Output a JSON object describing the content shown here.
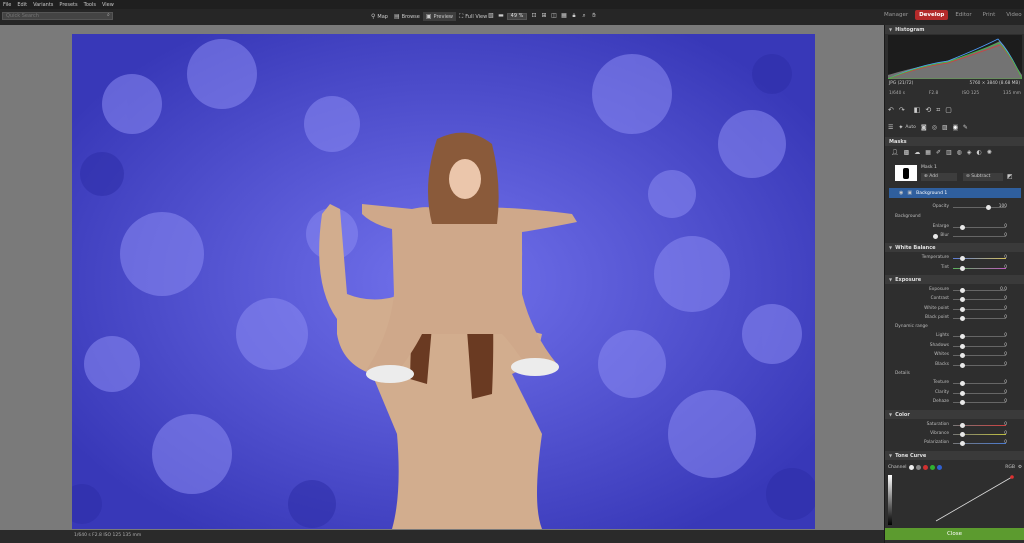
{
  "menu": [
    "File",
    "Edit",
    "Variants",
    "Presets",
    "Tools",
    "View"
  ],
  "search": {
    "placeholder": "Quick Search"
  },
  "view_modes": [
    {
      "icon": "map-pin-icon",
      "label": "Map"
    },
    {
      "icon": "folder-icon",
      "label": "Browse"
    },
    {
      "icon": "preview-icon",
      "label": "Preview"
    },
    {
      "icon": "fullscreen-icon",
      "label": "Full View"
    }
  ],
  "toolbar": {
    "zoom": "49 %"
  },
  "modules": [
    "Manager",
    "Develop",
    "Editor",
    "Print",
    "Video"
  ],
  "modules_active": "Develop",
  "status": {
    "text": "1/640 s   F2.8   ISO 125   135 mm"
  },
  "histogram": {
    "title": "Histogram",
    "file_type": "JPG",
    "index": "(21/72)",
    "dimensions": "5760 × 3840 (8.68 MB)",
    "shutter": "1/640 s",
    "aperture": "F2.8",
    "iso": "ISO 125",
    "focal": "135 mm"
  },
  "quick_labels": {
    "auto": "Auto"
  },
  "masks": {
    "title": "Masks",
    "mask_name": "Mask 1",
    "add_label": "Add",
    "subtract_label": "Subtract",
    "layer_name": "Background 1",
    "opacity_label": "Opacity",
    "opacity_value": "100",
    "background_label": "Background",
    "enlarge_label": "Enlarge",
    "enlarge_value": "0",
    "blur_label": "Blur",
    "blur_value": "0"
  },
  "white_balance": {
    "title": "White Balance",
    "rows": [
      {
        "label": "Temperature",
        "value": "0"
      },
      {
        "label": "Tint",
        "value": "0"
      }
    ]
  },
  "exposure": {
    "title": "Exposure",
    "rows": [
      {
        "label": "Exposure",
        "value": "0.0"
      },
      {
        "label": "Contrast",
        "value": "0"
      },
      {
        "label": "White point",
        "value": "0"
      },
      {
        "label": "Black point",
        "value": "0"
      }
    ],
    "dynamic_label": "Dynamic range",
    "dynamic_rows": [
      {
        "label": "Lights",
        "value": "0"
      },
      {
        "label": "Shadows",
        "value": "0"
      },
      {
        "label": "Whites",
        "value": "0"
      },
      {
        "label": "Blacks",
        "value": "0"
      }
    ],
    "details_label": "Details",
    "details_rows": [
      {
        "label": "Texture",
        "value": "0"
      },
      {
        "label": "Clarity",
        "value": "0"
      },
      {
        "label": "Dehaze",
        "value": "0"
      }
    ]
  },
  "color": {
    "title": "Color",
    "rows": [
      {
        "label": "Saturation",
        "value": "0"
      },
      {
        "label": "Vibrance",
        "value": "0"
      },
      {
        "label": "Polarization",
        "value": "0"
      }
    ]
  },
  "tone_curve": {
    "title": "Tone Curve",
    "channel_label": "Channel",
    "mode_label": "RGB"
  },
  "close_label": "Close",
  "colors": {
    "accent": "#b32a2a",
    "mask_overlay": "#4a4ad6",
    "close": "#5c9b2f",
    "selected_layer": "#2f5f9e"
  }
}
